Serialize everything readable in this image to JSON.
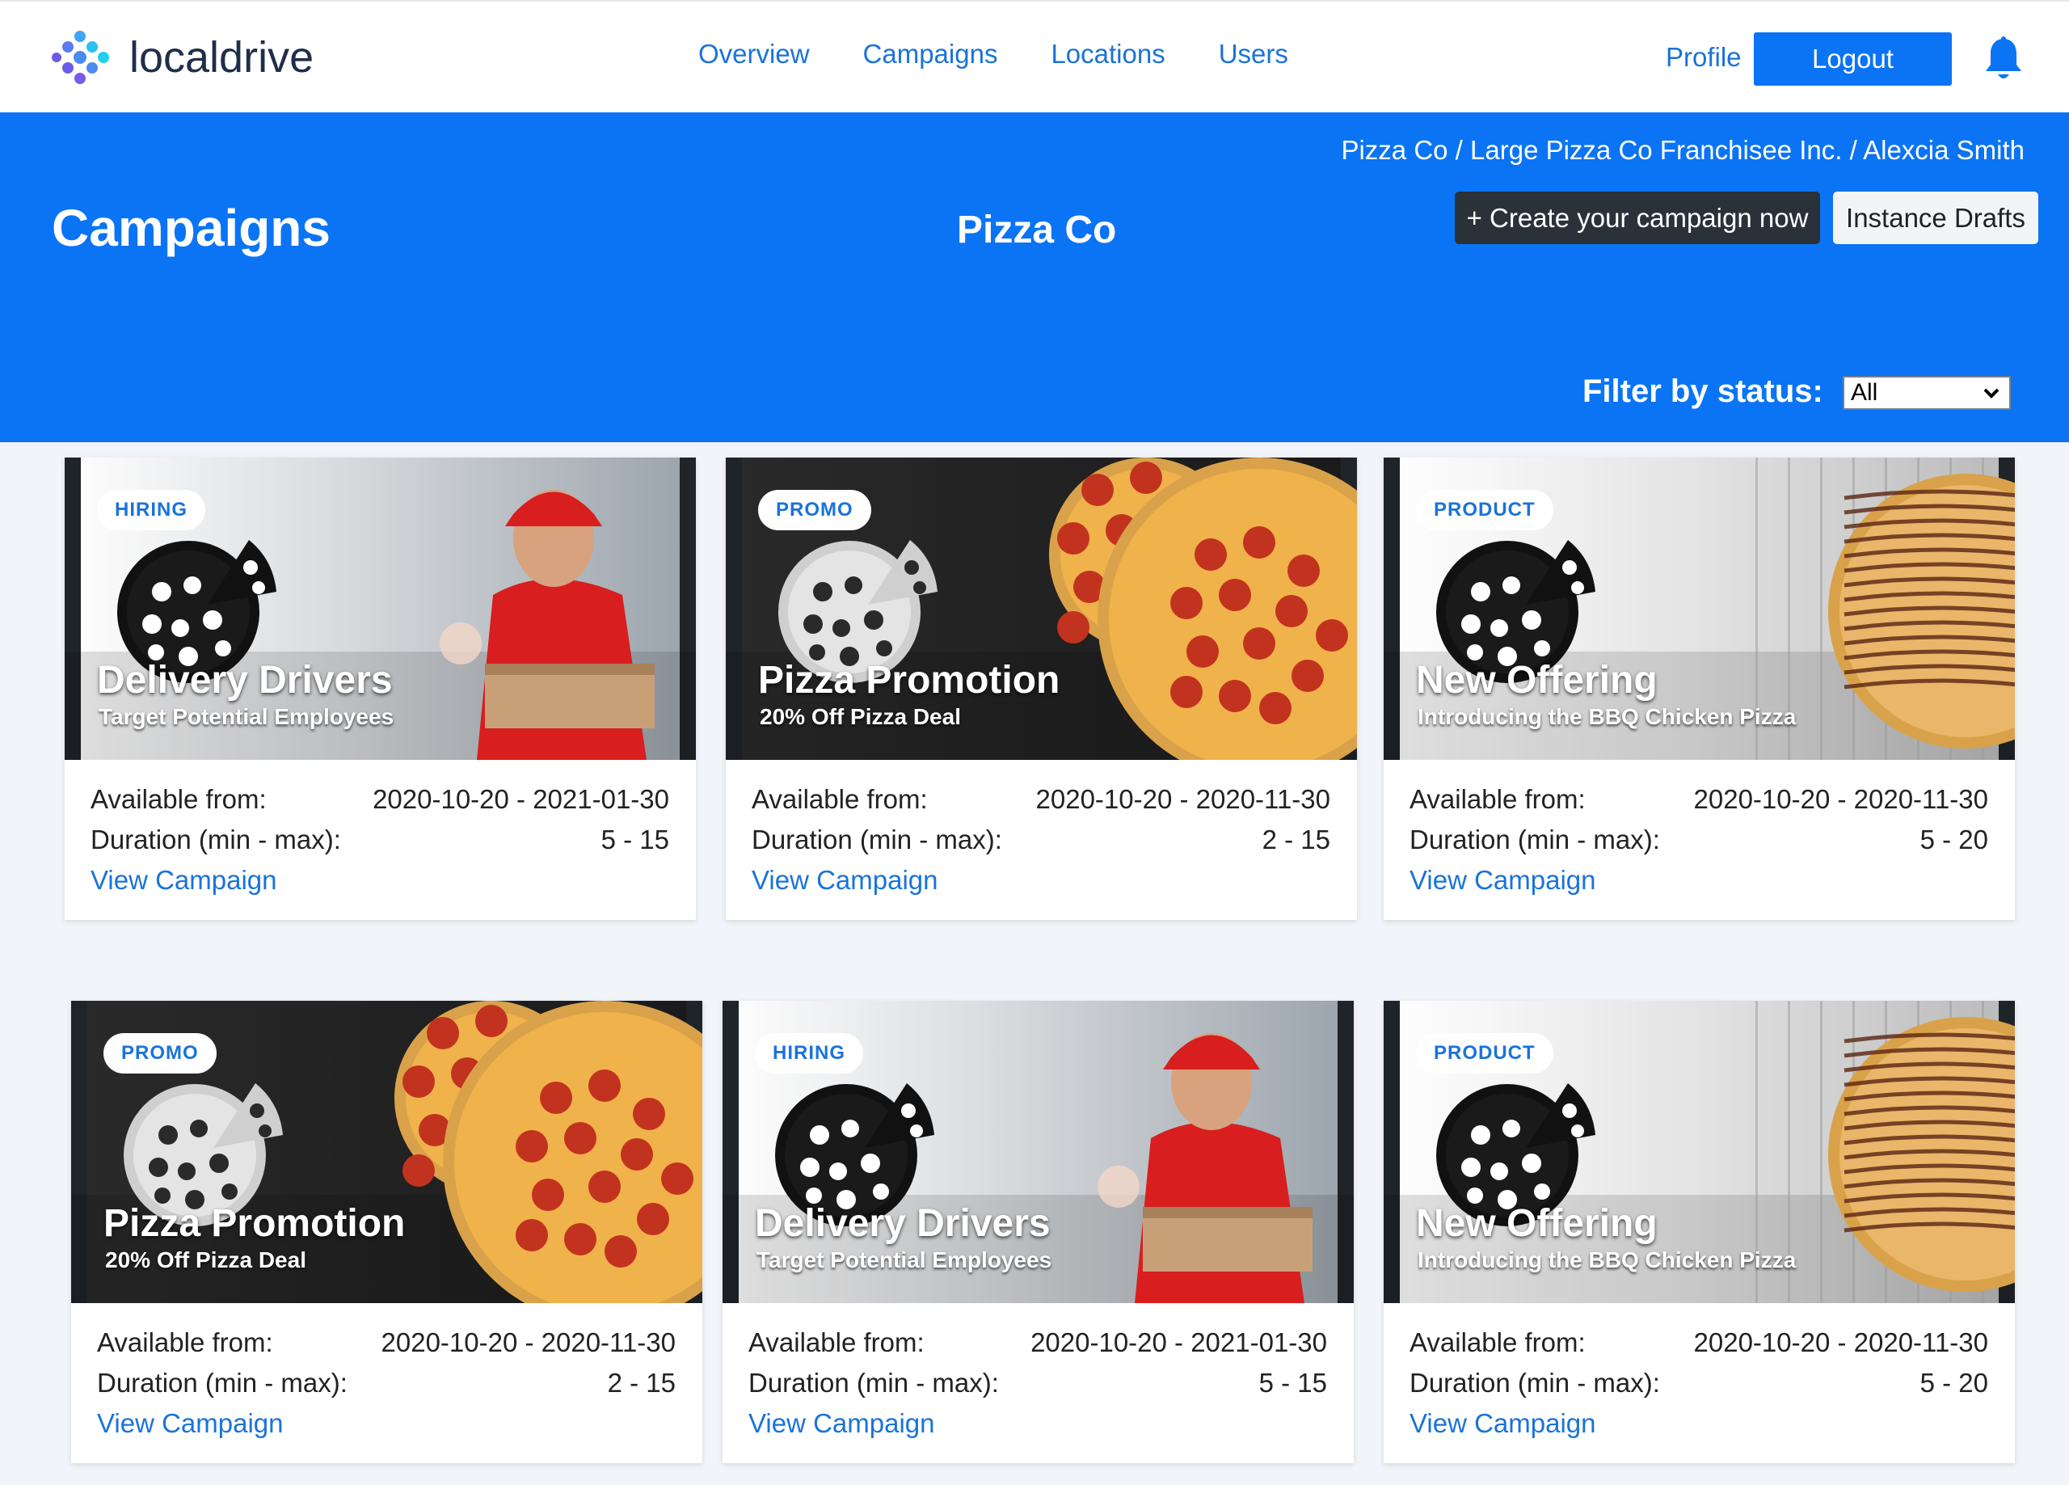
{
  "brand": {
    "name": "localdrive"
  },
  "nav": {
    "items": [
      "Overview",
      "Campaigns",
      "Locations",
      "Users"
    ],
    "profile": "Profile",
    "logout": "Logout"
  },
  "header": {
    "breadcrumb": "Pizza Co / Large Pizza Co Franchisee Inc. / Alexcia Smith",
    "title": "Campaigns",
    "org": "Pizza Co",
    "create_button": "+ Create your campaign now",
    "drafts_button": "Instance Drafts",
    "filter_label": "Filter by status:",
    "filter_value": "All"
  },
  "labels": {
    "available": "Available from:",
    "duration": "Duration (min - max):",
    "view": "View Campaign"
  },
  "colors": {
    "accent": "#0a74f5",
    "link": "#1a73d9",
    "dark_button": "#2b3138"
  },
  "cards": [
    {
      "badge": "HIRING",
      "title": "Delivery Drivers",
      "subtitle": "Target Potential Employees",
      "dates": "2020-10-20 - 2021-01-30",
      "duration": "5 - 15",
      "theme": "hiring"
    },
    {
      "badge": "PROMO",
      "title": "Pizza Promotion",
      "subtitle": "20% Off Pizza Deal",
      "dates": "2020-10-20 - 2020-11-30",
      "duration": "2 - 15",
      "theme": "promo"
    },
    {
      "badge": "PRODUCT",
      "title": "New Offering",
      "subtitle": "Introducing the BBQ Chicken Pizza",
      "dates": "2020-10-20 - 2020-11-30",
      "duration": "5 - 20",
      "theme": "product"
    },
    {
      "badge": "PROMO",
      "title": "Pizza Promotion",
      "subtitle": "20% Off Pizza Deal",
      "dates": "2020-10-20 - 2020-11-30",
      "duration": "2 - 15",
      "theme": "promo"
    },
    {
      "badge": "HIRING",
      "title": "Delivery Drivers",
      "subtitle": "Target Potential Employees",
      "dates": "2020-10-20 - 2021-01-30",
      "duration": "5 - 15",
      "theme": "hiring"
    },
    {
      "badge": "PRODUCT",
      "title": "New Offering",
      "subtitle": "Introducing the BBQ Chicken Pizza",
      "dates": "2020-10-20 - 2020-11-30",
      "duration": "5 - 20",
      "theme": "product"
    }
  ]
}
